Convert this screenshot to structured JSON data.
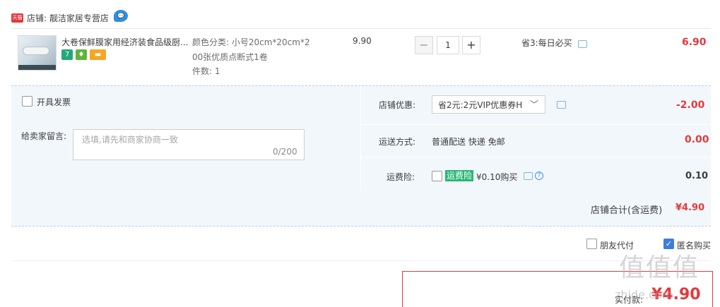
{
  "shop": {
    "badge": "天猫",
    "label": "店铺: 靓洁家居专营店"
  },
  "item": {
    "title": "大卷保鲜膜家用经济装食品级厨...",
    "tags": [
      "7",
      "",
      ""
    ],
    "sku_line1": "颜色分类: 小号20cm*20cm*2",
    "sku_line2": "00张优质点断式1卷",
    "count": "件数: 1",
    "unit_price": "9.90",
    "quantity": "1",
    "minus": "−",
    "plus": "+",
    "promo": "省3:每日必买",
    "total": "6.90"
  },
  "options": {
    "invoice_label": "开具发票",
    "note_label": "给卖家留言:",
    "note_placeholder": "选填,请先和商家协商一致",
    "note_count": "0/200",
    "coupon_label": "店铺优惠:",
    "coupon_value": "省2元:2元VIP优惠券H",
    "coupon_amount": "-2.00",
    "shipping_label": "运送方式:",
    "shipping_value": "普通配送 快递 免邮",
    "shipping_amount": "0.00",
    "insurance_label": "运费险:",
    "insurance_badge": "运费险",
    "insurance_price": "¥0.10购买",
    "insurance_amount": "0.10"
  },
  "subtotal": {
    "label": "店铺合计(含运费)",
    "value": "¥4.90"
  },
  "payment": {
    "friend_label": "朋友代付",
    "anon_label": "匿名购买",
    "anon_checked": true,
    "pay_label": "实付款:",
    "pay_value": "¥4.90"
  },
  "watermark": {
    "main": "值值值",
    "sub": "zhide.com"
  },
  "colors": {
    "accent_red": "#e4393c",
    "panel_bg": "#f2f7fc",
    "check_blue": "#3d7fd8"
  }
}
